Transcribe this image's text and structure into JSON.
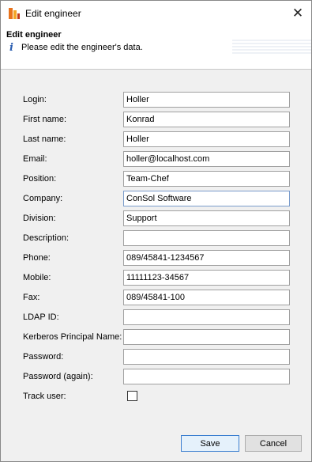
{
  "window": {
    "title": "Edit engineer",
    "close_glyph": "✕"
  },
  "banner": {
    "title": "Edit engineer",
    "info_glyph": "i",
    "message": "Please edit the engineer's data."
  },
  "form": {
    "fields": [
      {
        "label": "Login:",
        "value": "Holler"
      },
      {
        "label": "First name:",
        "value": "Konrad"
      },
      {
        "label": "Last name:",
        "value": "Holler"
      },
      {
        "label": "Email:",
        "value": "holler@localhost.com"
      },
      {
        "label": "Position:",
        "value": "Team-Chef"
      },
      {
        "label": "Company:",
        "value": "ConSol Software"
      },
      {
        "label": "Division:",
        "value": "Support"
      },
      {
        "label": "Description:",
        "value": ""
      },
      {
        "label": "Phone:",
        "value": "089/45841-1234567"
      },
      {
        "label": "Mobile:",
        "value": "11111123-34567"
      },
      {
        "label": "Fax:",
        "value": "089/45841-100"
      },
      {
        "label": "LDAP ID:",
        "value": ""
      },
      {
        "label": "Kerberos Principal Name:",
        "value": ""
      },
      {
        "label": "Password:",
        "value": ""
      },
      {
        "label": "Password (again):",
        "value": ""
      }
    ],
    "track_user": {
      "label": "Track user:",
      "checked": false
    }
  },
  "buttons": {
    "save": "Save",
    "cancel": "Cancel"
  }
}
